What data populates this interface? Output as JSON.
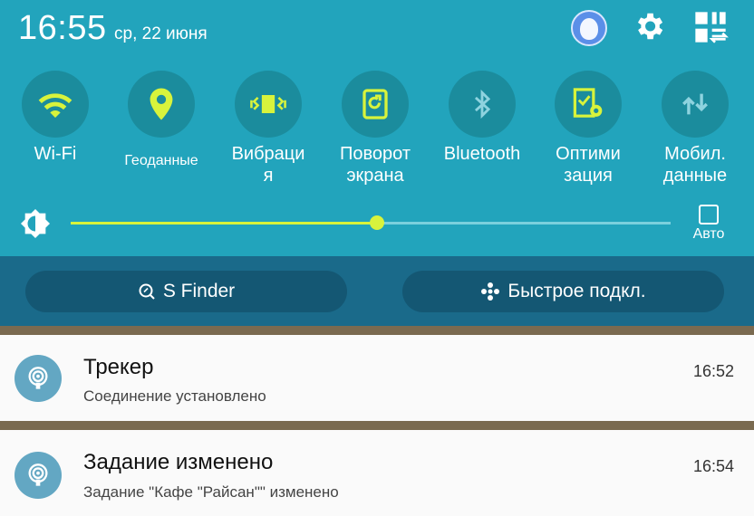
{
  "status": {
    "time": "16:55",
    "date": "ср, 22 июня"
  },
  "icons": {
    "avatar": "avatar-icon",
    "settings": "gear-icon",
    "edit": "edit-quick-settings-icon"
  },
  "toggles": [
    {
      "label": "Wi-Fi",
      "icon": "wifi-icon",
      "active": true
    },
    {
      "label": "Геоданные",
      "icon": "location-pin-icon",
      "active": true
    },
    {
      "label": "Вибраци\nя",
      "icon": "vibration-icon",
      "active": true
    },
    {
      "label": "Поворот\nэкрана",
      "icon": "rotate-icon",
      "active": true
    },
    {
      "label": "Bluetooth",
      "icon": "bluetooth-icon",
      "active": false
    },
    {
      "label": "Оптими\nзация",
      "icon": "optimize-icon",
      "active": true
    },
    {
      "label": "Мобил.\nданные",
      "icon": "mobile-data-icon",
      "active": false
    }
  ],
  "brightness": {
    "level": 0.51,
    "auto_label": "Авто",
    "auto_checked": false
  },
  "buttons": {
    "sfinder": "S Finder",
    "quick_connect": "Быстрое подкл."
  },
  "notifications": [
    {
      "title": "Трекер",
      "text": "Соединение установлено",
      "time": "16:52",
      "icon": "tracker-icon"
    },
    {
      "title": "Задание изменено",
      "text": "Задание \"Кафе \"Райсан\"\" изменено",
      "time": "16:54",
      "icon": "tracker-icon"
    }
  ],
  "colors": {
    "panel": "#22a4bc",
    "active_icon": "#d8f33c",
    "inactive_icon": "#8ed3df",
    "button_row": "#1a6a8a"
  }
}
